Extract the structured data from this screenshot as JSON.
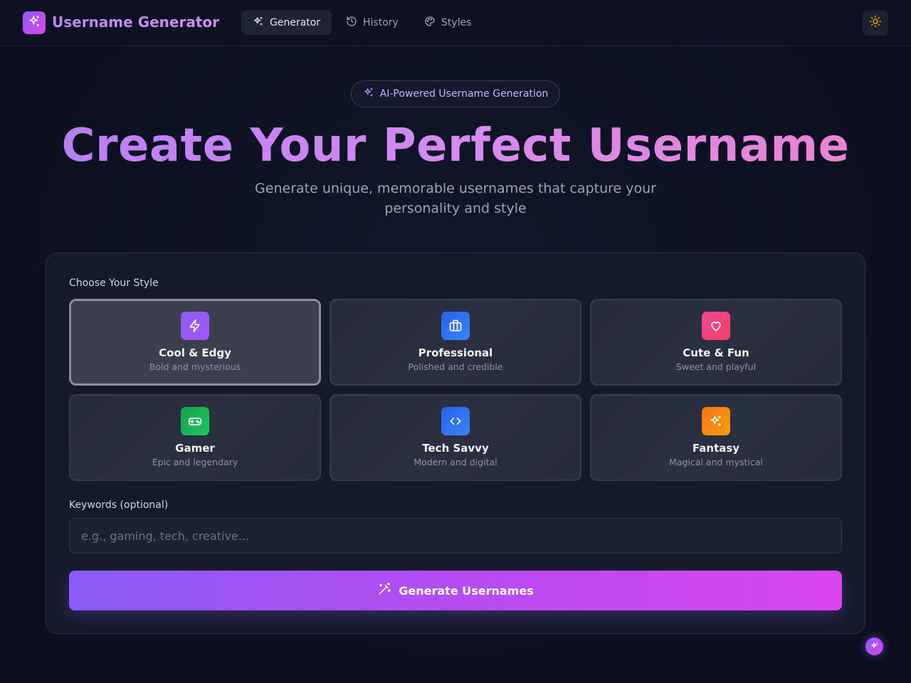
{
  "app": {
    "brand": "Username Generator",
    "logo_icon": "sparkles-icon"
  },
  "nav": {
    "items": [
      {
        "label": "Generator",
        "icon": "sparkles-icon",
        "active": true
      },
      {
        "label": "History",
        "icon": "history-icon",
        "active": false
      },
      {
        "label": "Styles",
        "icon": "palette-icon",
        "active": false
      }
    ],
    "theme_toggle_icon": "sun-icon"
  },
  "hero": {
    "badge": "AI-Powered Username Generation",
    "title": "Create Your Perfect Username",
    "subtitle": "Generate unique, memorable usernames that capture your personality and style"
  },
  "form": {
    "style_label": "Choose Your Style",
    "styles": [
      {
        "name": "Cool & Edgy",
        "desc": "Bold and mysterious",
        "icon": "bolt-icon",
        "color": "#8b5cf6",
        "selected": true
      },
      {
        "name": "Professional",
        "desc": "Polished and credible",
        "icon": "briefcase-icon",
        "color": "#3b82f6",
        "selected": false
      },
      {
        "name": "Cute & Fun",
        "desc": "Sweet and playful",
        "icon": "heart-icon",
        "color": "#ec4899",
        "selected": false
      },
      {
        "name": "Gamer",
        "desc": "Epic and legendary",
        "icon": "gamepad-icon",
        "color": "#22c55e",
        "selected": false
      },
      {
        "name": "Tech Savvy",
        "desc": "Modern and digital",
        "icon": "code-icon",
        "color": "#3b82f6",
        "selected": false
      },
      {
        "name": "Fantasy",
        "desc": "Magical and mystical",
        "icon": "sparkles-icon",
        "color": "#f97316",
        "selected": false
      }
    ],
    "keywords_label": "Keywords (optional)",
    "keywords_placeholder": "e.g., gaming, tech, creative...",
    "keywords_value": "",
    "generate_label": "Generate Usernames",
    "generate_icon": "magic-wand-icon"
  },
  "colors": {
    "accent_start": "#8b5cf6",
    "accent_end": "#d946ef",
    "theme_icon": "#f59e0b"
  }
}
